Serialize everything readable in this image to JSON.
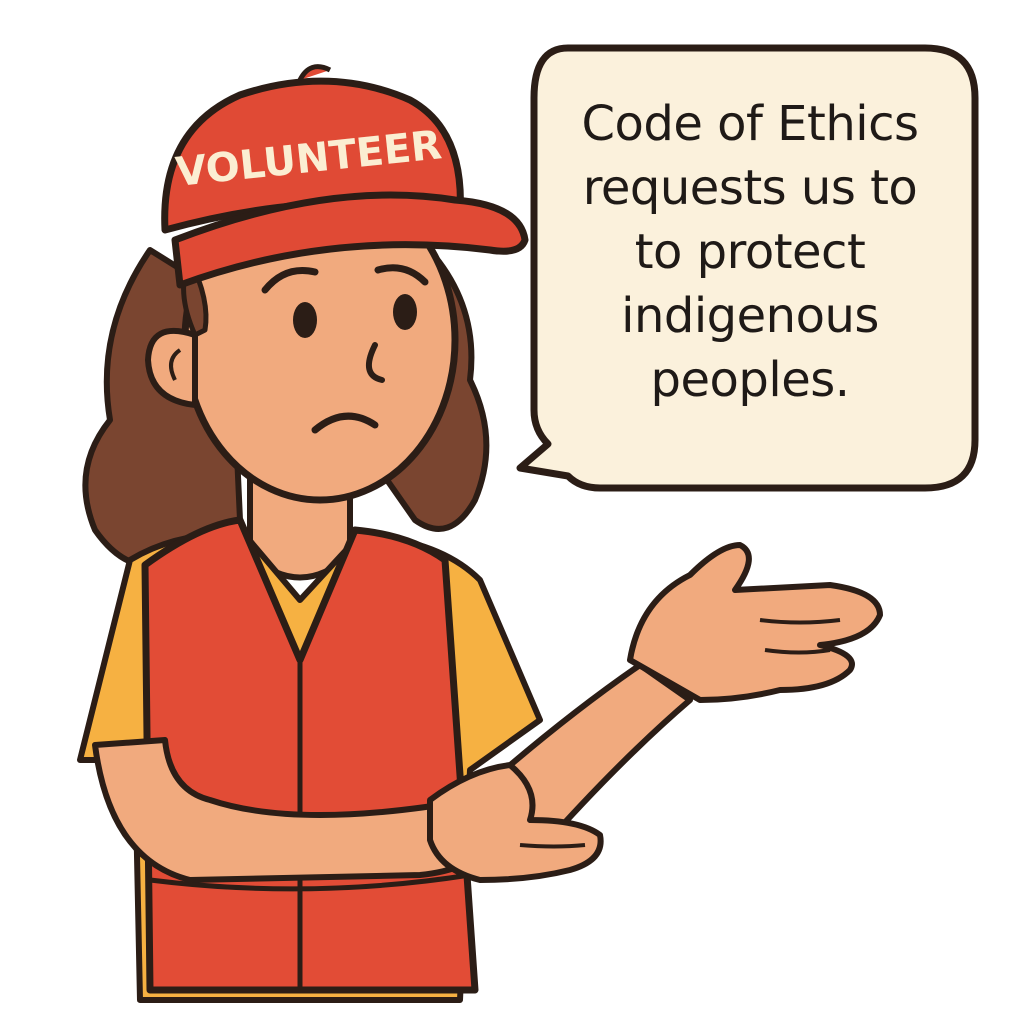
{
  "cap": {
    "label": "VOLUNTEER"
  },
  "speech_bubble": {
    "lines": [
      "Code of Ethics",
      "requests us to",
      "to protect",
      "indigenous",
      "peoples."
    ]
  },
  "colors": {
    "outline": "#2b1d16",
    "cap_red": "#e04a35",
    "cap_text": "#fbeed2",
    "vest_red": "#e24c36",
    "shirt_yellow": "#f6b142",
    "skin": "#f1aa7e",
    "hair_brown": "#7a4530",
    "bubble_fill": "#fbf1dc"
  }
}
